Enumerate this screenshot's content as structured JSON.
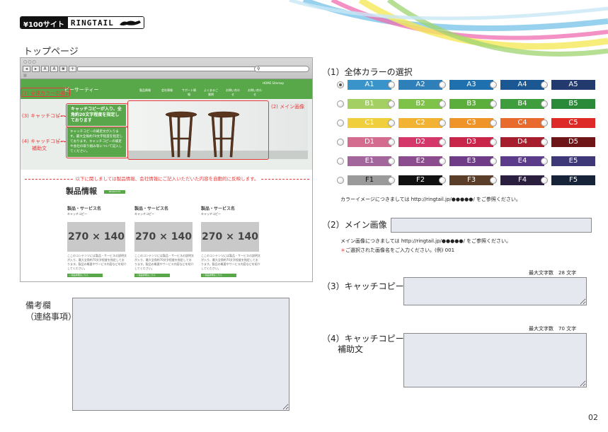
{
  "header": {
    "logo_left": "¥100サイト",
    "logo_right": "RINGTAIL",
    "page_title": "トップページ"
  },
  "mockup": {
    "top_links": "HOME  Sitemap",
    "site_title": "ピーサーティー",
    "nav": [
      "製品情報",
      "会社情報",
      "サポート情報",
      "よくあるご質問",
      "お問い合わせ",
      "お問い合わせ"
    ],
    "catch_copy": "キャッチコピーが入り、全角約20文字程度を指定しております",
    "sub_copy": "キャッチコピーの補足文が入ります。最大全角約70文字程度を指定しております。キャッチコピーの補足や会社の取り組み等について記入してください。",
    "annotations": {
      "color": "(1) 全体カラーの選択",
      "catch": "(3) キャッチコピー",
      "sub_line1": "(4) キャッチコピー",
      "sub_line2": "補助文",
      "image": "(2) メイン画像"
    },
    "notice": "以下に関しましては製品情報、会社情報にご記入いただいた内容を自動的に反映します。",
    "products_title": "製品情報",
    "products_badge": "PRODUCTS",
    "products": [
      {
        "name": "製品・サービス名",
        "catch": "キャッチコピー",
        "thumb": "270 × 140",
        "desc": "ここのコンテンツには製品・サービスの説明文が入り、最大全角約70文字程度を指定しております。製品の概要やサービス内容などを紹介してください。",
        "more": "» 製品詳細はこちら"
      },
      {
        "name": "製品・サービス名",
        "catch": "キャッチコピー",
        "thumb": "270 × 140",
        "desc": "ここのコンテンツには製品・サービスの説明文が入り、最大全角約70文字程度を指定しております。製品の概要やサービス内容などを紹介してください。",
        "more": "» 製品詳細はこちら"
      },
      {
        "name": "製品・サービス名",
        "catch": "キャッチコピー",
        "thumb": "270 × 140",
        "desc": "ここのコンテンツには製品・サービスの説明文が入り、最大全角約70文字程度を指定しております。製品の概要やサービス内容などを紹介してください。",
        "more": "» 製品詳細はこちら"
      }
    ]
  },
  "memo": {
    "label_line1": "備考欄",
    "label_line2": "（連絡事項）"
  },
  "form": {
    "color_section": "（1）全体カラーの選択",
    "selected": "A1",
    "colors": [
      [
        {
          "id": "A1",
          "bg": "#3a93c9",
          "fg": "#ffffff"
        },
        {
          "id": "A2",
          "bg": "#2f7fb8",
          "fg": "#ffffff"
        },
        {
          "id": "A3",
          "bg": "#1f70ae",
          "fg": "#ffffff"
        },
        {
          "id": "A4",
          "bg": "#1b5792",
          "fg": "#ffffff"
        },
        {
          "id": "A5",
          "bg": "#233a6e",
          "fg": "#ffffff"
        }
      ],
      [
        {
          "id": "B1",
          "bg": "#a3cf63",
          "fg": "#ffffff"
        },
        {
          "id": "B2",
          "bg": "#7ec24a",
          "fg": "#ffffff"
        },
        {
          "id": "B3",
          "bg": "#5cae3c",
          "fg": "#ffffff"
        },
        {
          "id": "B4",
          "bg": "#409d3e",
          "fg": "#ffffff"
        },
        {
          "id": "B5",
          "bg": "#2b8a3a",
          "fg": "#ffffff"
        }
      ],
      [
        {
          "id": "C1",
          "bg": "#f0cf3d",
          "fg": "#ffffff"
        },
        {
          "id": "C2",
          "bg": "#f2b233",
          "fg": "#ffffff"
        },
        {
          "id": "C3",
          "bg": "#ef9428",
          "fg": "#ffffff"
        },
        {
          "id": "C4",
          "bg": "#e86a2c",
          "fg": "#ffffff"
        },
        {
          "id": "C5",
          "bg": "#de2a26",
          "fg": "#ffffff"
        }
      ],
      [
        {
          "id": "D1",
          "bg": "#d46c8f",
          "fg": "#ffffff"
        },
        {
          "id": "D2",
          "bg": "#d4386a",
          "fg": "#ffffff"
        },
        {
          "id": "D3",
          "bg": "#c9244a",
          "fg": "#ffffff"
        },
        {
          "id": "D4",
          "bg": "#a61e2e",
          "fg": "#ffffff"
        },
        {
          "id": "D5",
          "bg": "#6e1518",
          "fg": "#ffffff"
        }
      ],
      [
        {
          "id": "E1",
          "bg": "#a2669d",
          "fg": "#ffffff"
        },
        {
          "id": "E2",
          "bg": "#8b4d8e",
          "fg": "#ffffff"
        },
        {
          "id": "E3",
          "bg": "#6f3d88",
          "fg": "#ffffff"
        },
        {
          "id": "E4",
          "bg": "#5b3b8a",
          "fg": "#ffffff"
        },
        {
          "id": "E5",
          "bg": "#3e3778",
          "fg": "#ffffff"
        }
      ],
      [
        {
          "id": "F1",
          "bg": "#9a9a9a",
          "fg": "#111111"
        },
        {
          "id": "F2",
          "bg": "#111111",
          "fg": "#ffffff"
        },
        {
          "id": "F3",
          "bg": "#5a3e2a",
          "fg": "#ffffff"
        },
        {
          "id": "F4",
          "bg": "#2a1f3f",
          "fg": "#ffffff"
        },
        {
          "id": "F5",
          "bg": "#162338",
          "fg": "#ffffff"
        }
      ]
    ],
    "color_note": "カラーイメージにつきましては http://ringtail.jp/●●●●●/ をご参照ください。",
    "image_section": "（2）メイン画像",
    "image_note1": "メイン画像につきましては http://ringtail.jp/●●●●●/ をご参照ください。",
    "image_note2_star": "＊",
    "image_note2": "ご選択された画像名をご入力ください。(例) 001",
    "catch_limit": "最大文字数　28 文字",
    "catch_section": "（3）キャッチコピー",
    "sub_limit": "最大文字数　70 文字",
    "sub_section_line1": "（4）キャッチコピー",
    "sub_section_line2": "補助文"
  },
  "page_number": "02"
}
